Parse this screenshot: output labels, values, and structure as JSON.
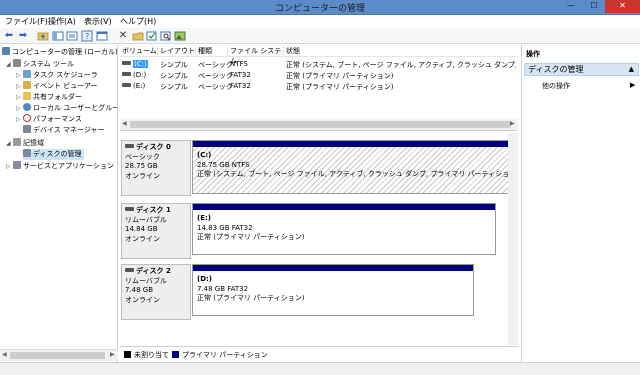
{
  "window": {
    "title": "コンピューターの管理",
    "minimize": "—",
    "maximize": "☐",
    "close": "✕"
  },
  "menu": {
    "items": [
      "ファイル(F)",
      "操作(A)",
      "表示(V)",
      "ヘルプ(H)"
    ]
  },
  "tree": {
    "items": [
      {
        "label": "コンピューターの管理 (ローカル)"
      },
      {
        "label": "システム ツール"
      },
      {
        "label": "タスク スケジューラ"
      },
      {
        "label": "イベント ビューアー"
      },
      {
        "label": "共有フォルダー"
      },
      {
        "label": "ローカル ユーザーとグループ"
      },
      {
        "label": "パフォーマンス"
      },
      {
        "label": "デバイス マネージャー"
      },
      {
        "label": "記憶域"
      },
      {
        "label": "ディスクの管理"
      },
      {
        "label": "サービスとアプリケーション"
      }
    ]
  },
  "volumes": {
    "columns": [
      "ボリューム",
      "レイアウト",
      "種類",
      "ファイル システム",
      "状態"
    ],
    "rows": [
      {
        "name": "(C:)",
        "layout": "シンプル",
        "type": "ベーシック",
        "fs": "NTFS",
        "status": "正常 (システム, ブート, ページ ファイル, アクティブ, クラッシュ ダンプ, プライマリ"
      },
      {
        "name": "(D:)",
        "layout": "シンプル",
        "type": "ベーシック",
        "fs": "FAT32",
        "status": "正常 (プライマリ パーティション)"
      },
      {
        "name": "(E:)",
        "layout": "シンプル",
        "type": "ベーシック",
        "fs": "FAT32",
        "status": "正常 (プライマリ パーティション)"
      }
    ]
  },
  "disks": [
    {
      "name": "ディスク 0",
      "type": "ベーシック",
      "size": "28.75 GB",
      "state": "オンライン",
      "partition": {
        "letter": "(C:)",
        "size_fs": "28.75 GB NTFS",
        "status": "正常 (システム, ブート, ページ ファイル, アクティブ, クラッシュ ダンプ, プライマリ パーティション)"
      }
    },
    {
      "name": "ディスク 1",
      "type": "リムーバブル",
      "size": "14.84 GB",
      "state": "オンライン",
      "partition": {
        "letter": "(E:)",
        "size_fs": "14.83 GB FAT32",
        "status": "正常 (プライマリ パーティション)"
      }
    },
    {
      "name": "ディスク 2",
      "type": "リムーバブル",
      "size": "7.48 GB",
      "state": "オンライン",
      "partition": {
        "letter": "(D:)",
        "size_fs": "7.48 GB FAT32",
        "status": "正常 (プライマリ パーティション)"
      }
    }
  ],
  "legend": {
    "unallocated": "未割り当て",
    "primary": "プライマリ パーティション",
    "unallocated_color": "#000000",
    "primary_color": "#00007f"
  },
  "actions": {
    "title": "操作",
    "group": "ディスクの管理",
    "item": "他の操作"
  },
  "colors": {
    "titlebar": "#5b8cc9",
    "partition_header": "#00007f",
    "selection": "#3399ff",
    "action_group": "#d6e4f3"
  },
  "icons": {
    "back": "arrow-left-icon",
    "forward": "arrow-right-icon",
    "delete": "x-icon",
    "help": "help-icon"
  }
}
